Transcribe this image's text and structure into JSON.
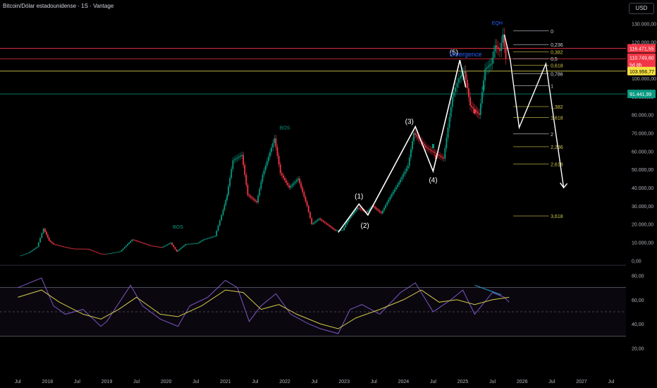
{
  "header": {
    "title": "Bitcoin/Dólar estadounidense · 1S · Vantage",
    "currency": "USD"
  },
  "chart_data": {
    "type": "candlestick",
    "price_axis": {
      "ticks": [
        "130.000,00",
        "120.000,00",
        "110.000,00",
        "100.000,00",
        "90.000,00",
        "80.000,00",
        "70.000,00",
        "60.000,00",
        "50.000,00",
        "40.000,00",
        "30.000,00",
        "20.000,00",
        "10.000,00",
        "0,00"
      ],
      "values": [
        130000,
        120000,
        110000,
        100000,
        90000,
        80000,
        70000,
        60000,
        50000,
        40000,
        30000,
        20000,
        10000,
        0
      ],
      "ylim": [
        -1000,
        136000
      ]
    },
    "price_labels": [
      {
        "text": "116.471,55",
        "value": 116471,
        "color": "#f23645",
        "text_color": "#ffffff"
      },
      {
        "text": "110.749,80",
        "value": 111400,
        "color": "#f23645",
        "text_color": "#ffffff"
      },
      {
        "text": "5d 8h",
        "value": 107600,
        "color": "#f23645",
        "text_color": "#ffffff"
      },
      {
        "text": "103.956,77",
        "value": 103956,
        "color": "#f5e142",
        "text_color": "#000000"
      },
      {
        "text": "91.441,99",
        "value": 91441,
        "color": "#089981",
        "text_color": "#ffffff"
      }
    ],
    "hlines": [
      {
        "value": 116471,
        "color": "#f23645"
      },
      {
        "value": 110749,
        "color": "#f23645"
      },
      {
        "value": 103956,
        "color": "#d4c94a"
      },
      {
        "value": 91441,
        "color": "#089981"
      }
    ],
    "x_axis": {
      "labels": [
        "Jul",
        "2018",
        "Jul",
        "2019",
        "Jul",
        "2020",
        "Jul",
        "2021",
        "Jul",
        "2022",
        "Jul",
        "2023",
        "Jul",
        "2024",
        "Jul",
        "2025",
        "Jul",
        "2026",
        "Jul",
        "2027",
        "Jul"
      ],
      "positions": [
        2017.5,
        2018,
        2018.5,
        2019,
        2019.5,
        2020,
        2020.5,
        2021,
        2021.5,
        2022,
        2022.5,
        2023,
        2023.5,
        2024,
        2024.5,
        2025,
        2025.5,
        2026,
        2026.5,
        2027,
        2027.5
      ]
    },
    "price_series": [
      [
        2017.55,
        2500
      ],
      [
        2017.7,
        4200
      ],
      [
        2017.85,
        7500
      ],
      [
        2017.96,
        17500
      ],
      [
        2018.05,
        11000
      ],
      [
        2018.12,
        9000
      ],
      [
        2018.3,
        7500
      ],
      [
        2018.45,
        6500
      ],
      [
        2018.7,
        6400
      ],
      [
        2018.9,
        3800
      ],
      [
        2019.0,
        3600
      ],
      [
        2019.25,
        5000
      ],
      [
        2019.45,
        11500
      ],
      [
        2019.55,
        10500
      ],
      [
        2019.75,
        8200
      ],
      [
        2019.95,
        7200
      ],
      [
        2020.1,
        9800
      ],
      [
        2020.2,
        5000
      ],
      [
        2020.35,
        9000
      ],
      [
        2020.55,
        9500
      ],
      [
        2020.65,
        11500
      ],
      [
        2020.85,
        13500
      ],
      [
        2020.96,
        25000
      ],
      [
        2021.05,
        36000
      ],
      [
        2021.15,
        55000
      ],
      [
        2021.3,
        58000
      ],
      [
        2021.4,
        36000
      ],
      [
        2021.55,
        32000
      ],
      [
        2021.65,
        47000
      ],
      [
        2021.85,
        67000
      ],
      [
        2021.95,
        48000
      ],
      [
        2022.1,
        40000
      ],
      [
        2022.25,
        45000
      ],
      [
        2022.4,
        30000
      ],
      [
        2022.48,
        20000
      ],
      [
        2022.6,
        23000
      ],
      [
        2022.75,
        19500
      ],
      [
        2022.87,
        16500
      ],
      [
        2023.0,
        16800
      ],
      [
        2023.1,
        23000
      ],
      [
        2023.25,
        29000
      ],
      [
        2023.4,
        26500
      ],
      [
        2023.5,
        30000
      ],
      [
        2023.65,
        26000
      ],
      [
        2023.8,
        35000
      ],
      [
        2023.95,
        43000
      ],
      [
        2024.1,
        52000
      ],
      [
        2024.2,
        70000
      ],
      [
        2024.4,
        62000
      ],
      [
        2024.6,
        58000
      ],
      [
        2024.7,
        56000
      ],
      [
        2024.85,
        90000
      ],
      [
        2024.96,
        100000
      ],
      [
        2025.05,
        104000
      ],
      [
        2025.15,
        85000
      ],
      [
        2025.3,
        80000
      ],
      [
        2025.4,
        105000
      ],
      [
        2025.5,
        108000
      ],
      [
        2025.57,
        118000
      ],
      [
        2025.65,
        115000
      ],
      [
        2025.7,
        124000
      ],
      [
        2025.75,
        110749
      ]
    ],
    "bars": [
      {
        "x": 2024.5,
        "y": 64000,
        "color": "#089981"
      },
      {
        "x": 2024.55,
        "y": 58000,
        "color": "#f23645"
      },
      {
        "x": 2025.2,
        "y": 83000,
        "color": "#f23645"
      },
      {
        "x": 2025.35,
        "y": 96000,
        "color": "#089981"
      }
    ],
    "wave_labels": [
      {
        "text": "(1)",
        "x": 2023.25,
        "y": 34000
      },
      {
        "text": "(2)",
        "x": 2023.35,
        "y": 18000
      },
      {
        "text": "(3)",
        "x": 2024.1,
        "y": 75000
      },
      {
        "text": "(4)",
        "x": 2024.5,
        "y": 43000
      },
      {
        "text": "(5)",
        "x": 2024.85,
        "y": 113000
      }
    ],
    "wave_path": [
      [
        2022.9,
        15500
      ],
      [
        2023.25,
        31000
      ],
      [
        2023.4,
        25000
      ],
      [
        2024.2,
        73500
      ],
      [
        2024.5,
        49000
      ],
      [
        2024.95,
        110000
      ],
      [
        2025.05,
        95000
      ]
    ],
    "projection_path": [
      [
        2025.7,
        124000
      ],
      [
        2025.8,
        110000
      ],
      [
        2025.95,
        73000
      ],
      [
        2026.4,
        108000
      ],
      [
        2026.7,
        40000
      ]
    ],
    "fib_levels": [
      {
        "label": "0",
        "value": 126000,
        "color": "#d1d4dc"
      },
      {
        "label": "0,236",
        "value": 118500,
        "color": "#d1d4dc"
      },
      {
        "label": "0,382",
        "value": 114500,
        "color": "#d4c94a"
      },
      {
        "label": "0,5",
        "value": 110800,
        "color": "#d1d4dc"
      },
      {
        "label": "0,618",
        "value": 107200,
        "color": "#d4c94a"
      },
      {
        "label": "0,786",
        "value": 102500,
        "color": "#d1d4dc"
      },
      {
        "label": "1",
        "value": 96000,
        "color": "#d1d4dc"
      },
      {
        "label": "1,382",
        "value": 84500,
        "color": "#d4c94a"
      },
      {
        "label": "1,618",
        "value": 78500,
        "color": "#d4c94a"
      },
      {
        "label": "2",
        "value": 69500,
        "color": "#d1d4dc"
      },
      {
        "label": "2,236",
        "value": 62500,
        "color": "#d4c94a"
      },
      {
        "label": "2,618",
        "value": 53000,
        "color": "#d4c94a"
      },
      {
        "label": "3,618",
        "value": 24500,
        "color": "#d4c94a"
      }
    ],
    "annotations": [
      {
        "text": "EQH",
        "x": 2025.58,
        "y": 129500,
        "color": "#2962ff"
      },
      {
        "text": "Divergence",
        "x": 2025.05,
        "y": 112000,
        "color": "#2962ff"
      },
      {
        "text": "BOS",
        "x": 2022.0,
        "y": 72000,
        "color": "#089981"
      },
      {
        "text": "BOS",
        "x": 2020.2,
        "y": 17500,
        "color": "#089981"
      }
    ],
    "rsi": {
      "ticks": [
        "80,00",
        "60,00",
        "40,00",
        "20,00"
      ],
      "values": [
        80,
        60,
        40,
        20
      ],
      "ylim": [
        15,
        85
      ],
      "bands": [
        70,
        50,
        30
      ],
      "series": [
        [
          2017.5,
          70
        ],
        [
          2017.9,
          78
        ],
        [
          2018.1,
          55
        ],
        [
          2018.3,
          48
        ],
        [
          2018.6,
          52
        ],
        [
          2018.9,
          38
        ],
        [
          2019.0,
          42
        ],
        [
          2019.4,
          72
        ],
        [
          2019.6,
          55
        ],
        [
          2019.9,
          44
        ],
        [
          2020.2,
          38
        ],
        [
          2020.4,
          55
        ],
        [
          2020.7,
          62
        ],
        [
          2021.0,
          76
        ],
        [
          2021.2,
          70
        ],
        [
          2021.4,
          42
        ],
        [
          2021.6,
          55
        ],
        [
          2021.85,
          65
        ],
        [
          2022.1,
          48
        ],
        [
          2022.4,
          40
        ],
        [
          2022.6,
          36
        ],
        [
          2022.9,
          32
        ],
        [
          2023.1,
          52
        ],
        [
          2023.3,
          56
        ],
        [
          2023.6,
          48
        ],
        [
          2023.95,
          66
        ],
        [
          2024.2,
          74
        ],
        [
          2024.5,
          50
        ],
        [
          2024.8,
          60
        ],
        [
          2025.0,
          68
        ],
        [
          2025.2,
          48
        ],
        [
          2025.5,
          66
        ],
        [
          2025.7,
          62
        ],
        [
          2025.78,
          58
        ]
      ],
      "ma": [
        [
          2017.5,
          62
        ],
        [
          2017.9,
          68
        ],
        [
          2018.2,
          58
        ],
        [
          2018.6,
          48
        ],
        [
          2018.9,
          44
        ],
        [
          2019.2,
          52
        ],
        [
          2019.5,
          62
        ],
        [
          2019.9,
          48
        ],
        [
          2020.2,
          46
        ],
        [
          2020.6,
          55
        ],
        [
          2021.0,
          68
        ],
        [
          2021.3,
          66
        ],
        [
          2021.6,
          52
        ],
        [
          2021.9,
          56
        ],
        [
          2022.2,
          48
        ],
        [
          2022.6,
          40
        ],
        [
          2022.9,
          36
        ],
        [
          2023.2,
          45
        ],
        [
          2023.6,
          52
        ],
        [
          2024.0,
          60
        ],
        [
          2024.3,
          68
        ],
        [
          2024.6,
          58
        ],
        [
          2024.9,
          60
        ],
        [
          2025.2,
          56
        ],
        [
          2025.5,
          60
        ],
        [
          2025.78,
          62
        ]
      ],
      "divergence_line": [
        [
          2025.2,
          72
        ],
        [
          2025.65,
          64
        ]
      ]
    }
  }
}
